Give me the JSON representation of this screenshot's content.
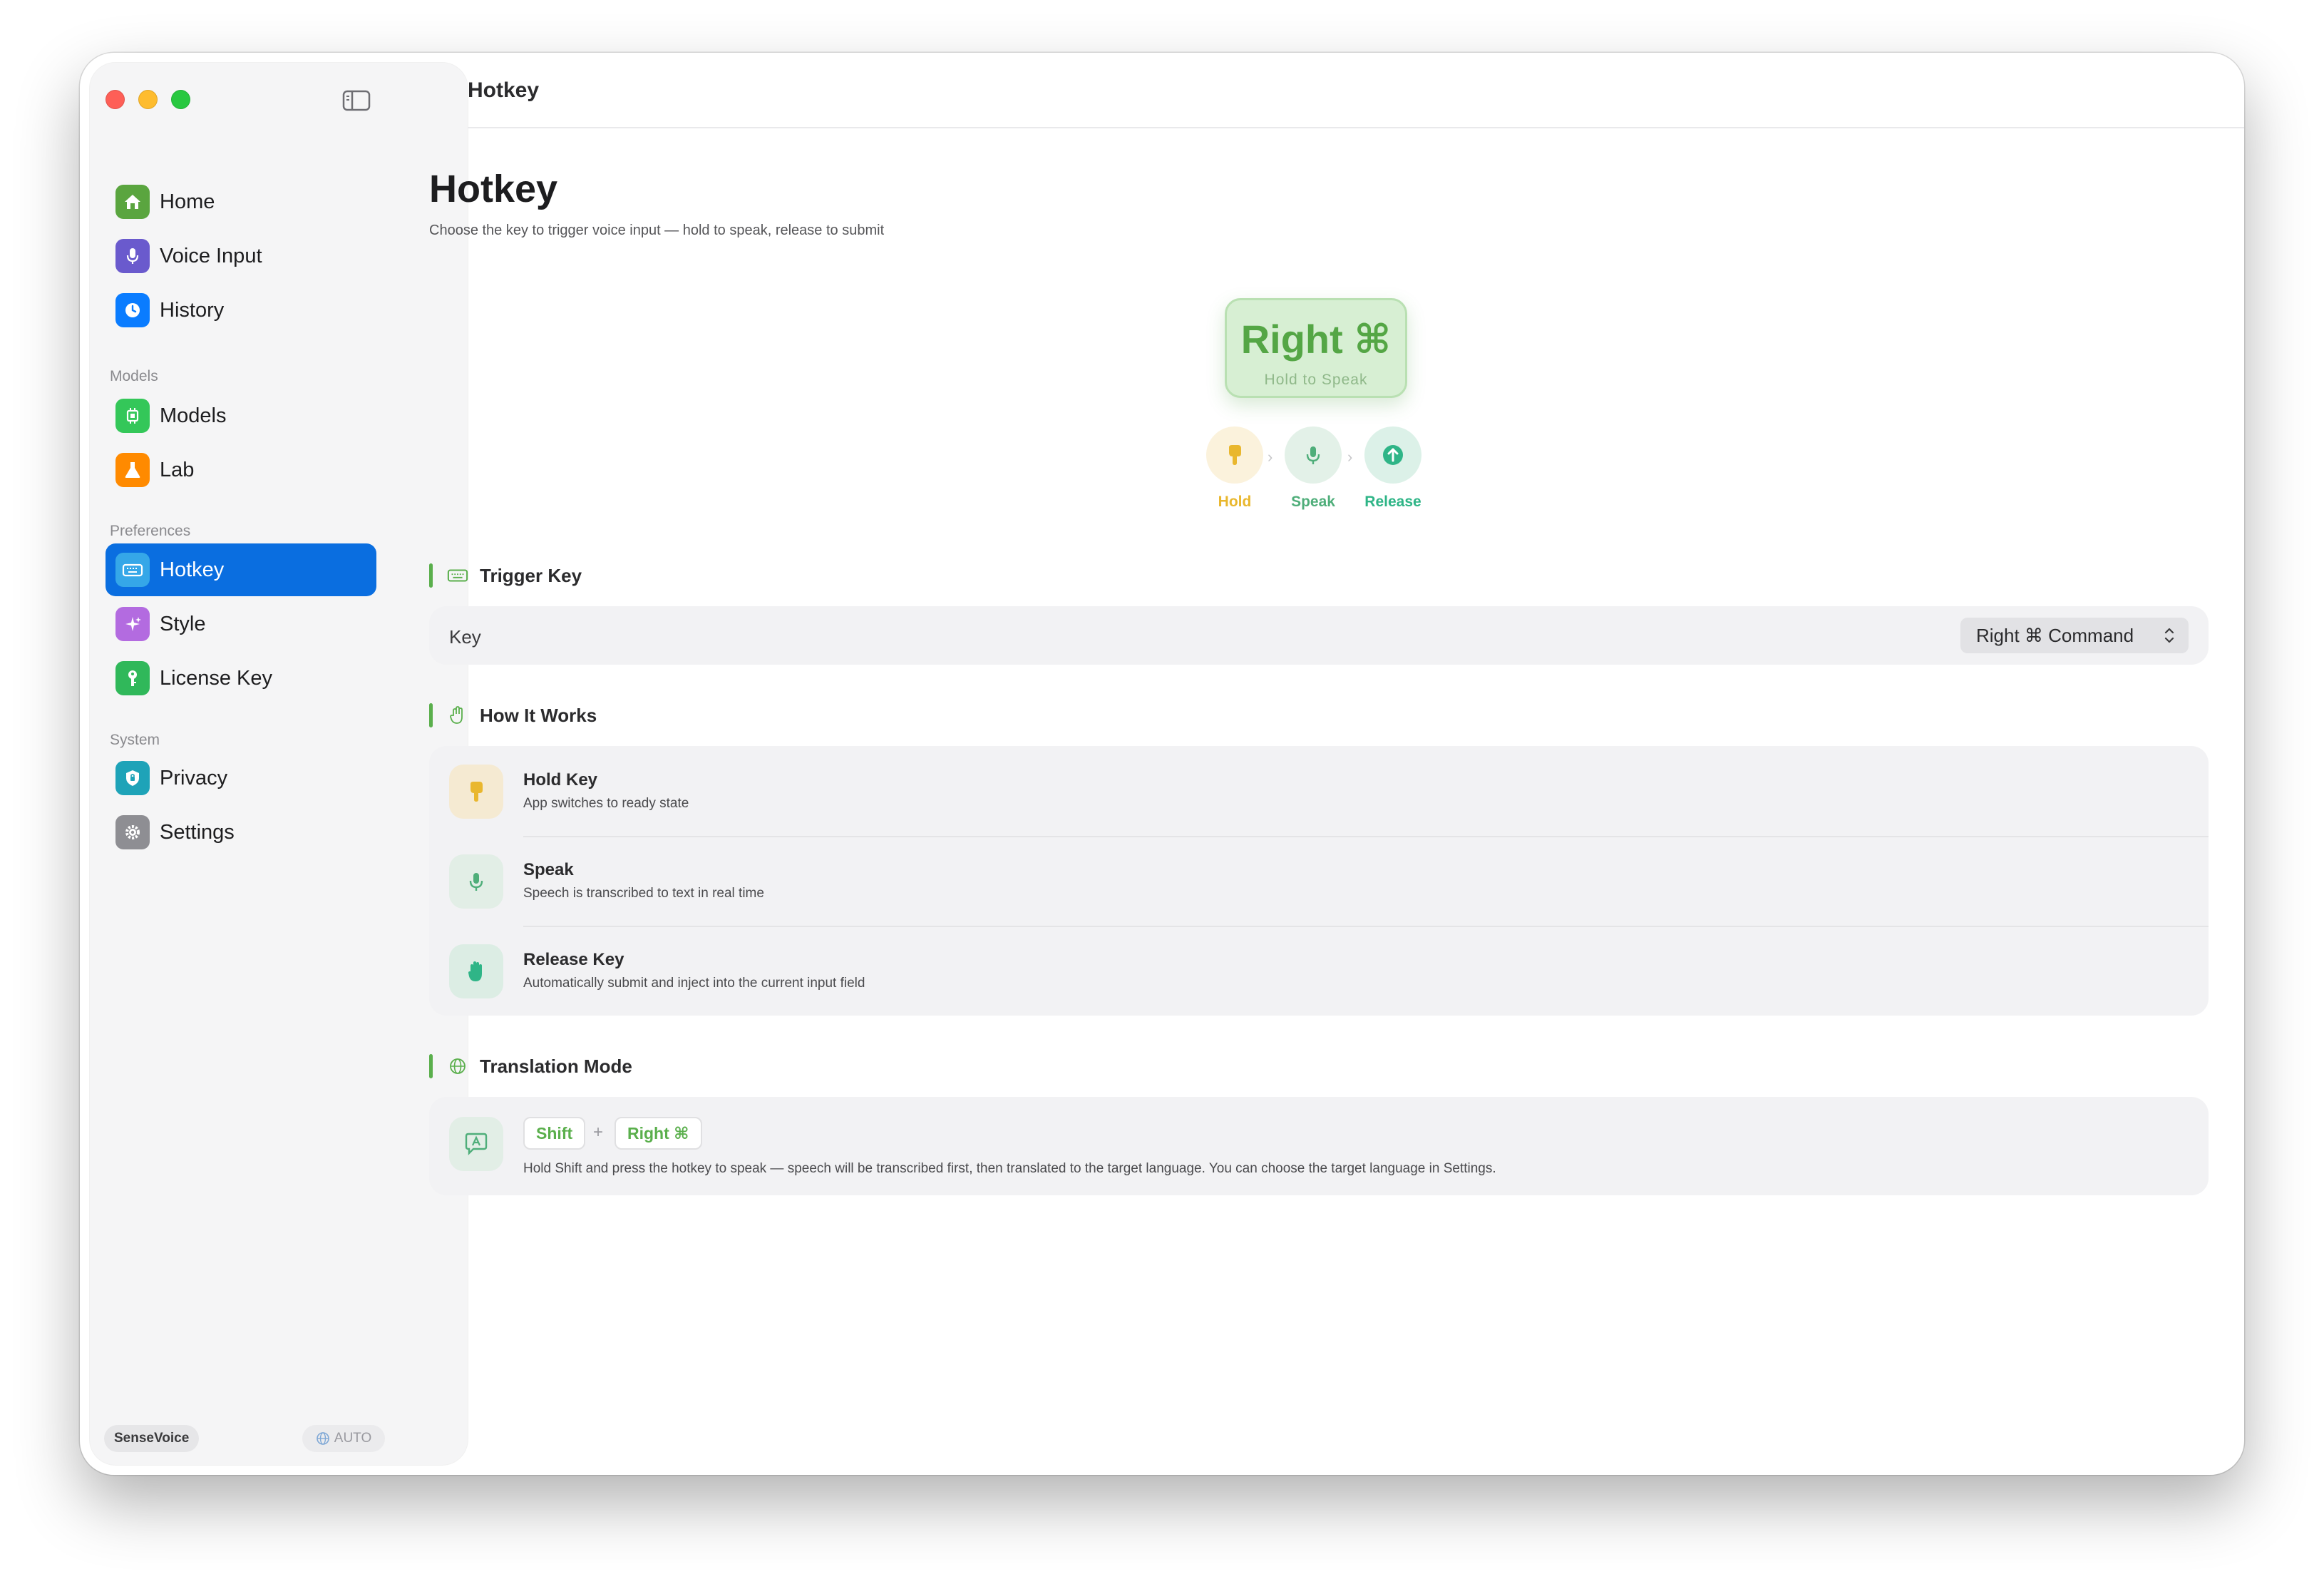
{
  "window": {
    "title": "Hotkey"
  },
  "sidebar": {
    "items_top": [
      {
        "label": "Home",
        "icon": "house-icon",
        "color": "#5aa53f"
      },
      {
        "label": "Voice Input",
        "icon": "microphone-icon",
        "color": "#6a5acd"
      },
      {
        "label": "History",
        "icon": "clock-icon",
        "color": "#0a7cff"
      }
    ],
    "section_models": "Models",
    "items_models": [
      {
        "label": "Models",
        "icon": "chip-icon",
        "color": "#34c759"
      },
      {
        "label": "Lab",
        "icon": "flask-icon",
        "color": "#ff8a00"
      }
    ],
    "section_preferences": "Preferences",
    "items_preferences": [
      {
        "label": "Hotkey",
        "icon": "keyboard-icon",
        "color": "#35a7e8",
        "active": true
      },
      {
        "label": "Style",
        "icon": "sparkles-icon",
        "color": "#b36be0"
      },
      {
        "label": "License Key",
        "icon": "key-icon",
        "color": "#30b85a"
      }
    ],
    "section_system": "System",
    "items_system": [
      {
        "label": "Privacy",
        "icon": "shield-icon",
        "color": "#1ea3b8"
      },
      {
        "label": "Settings",
        "icon": "gear-icon",
        "color": "#8e8e93"
      }
    ],
    "footer": {
      "model": "SenseVoice",
      "language": "AUTO"
    }
  },
  "main": {
    "title": "Hotkey",
    "subtitle": "Choose the key to trigger voice input — hold to speak, release to submit",
    "hero": {
      "key": "Right ⌘",
      "caption": "Hold to Speak",
      "accent": "#54a645"
    },
    "steps": [
      {
        "label": "Hold",
        "icon": "hand-down-icon",
        "color": "#e9b72e"
      },
      {
        "label": "Speak",
        "icon": "microphone-icon",
        "color": "#4fae7a"
      },
      {
        "label": "Release",
        "icon": "arrow-up-circle-icon",
        "color": "#2fb587"
      }
    ],
    "trigger": {
      "heading": "Trigger Key",
      "row_label": "Key",
      "selected": "Right ⌘ Command"
    },
    "how": {
      "heading": "How It Works",
      "rows": [
        {
          "title": "Hold Key",
          "desc": "App switches to ready state"
        },
        {
          "title": "Speak",
          "desc": "Speech is transcribed to text in real time"
        },
        {
          "title": "Release Key",
          "desc": "Automatically submit and inject into the current input field"
        }
      ]
    },
    "translation": {
      "heading": "Translation Mode",
      "key1": "Shift",
      "plus": "+",
      "key2": "Right ⌘",
      "desc": "Hold Shift and press the hotkey to speak — speech will be transcribed first, then translated to the target language. You can choose the target language in Settings."
    }
  }
}
